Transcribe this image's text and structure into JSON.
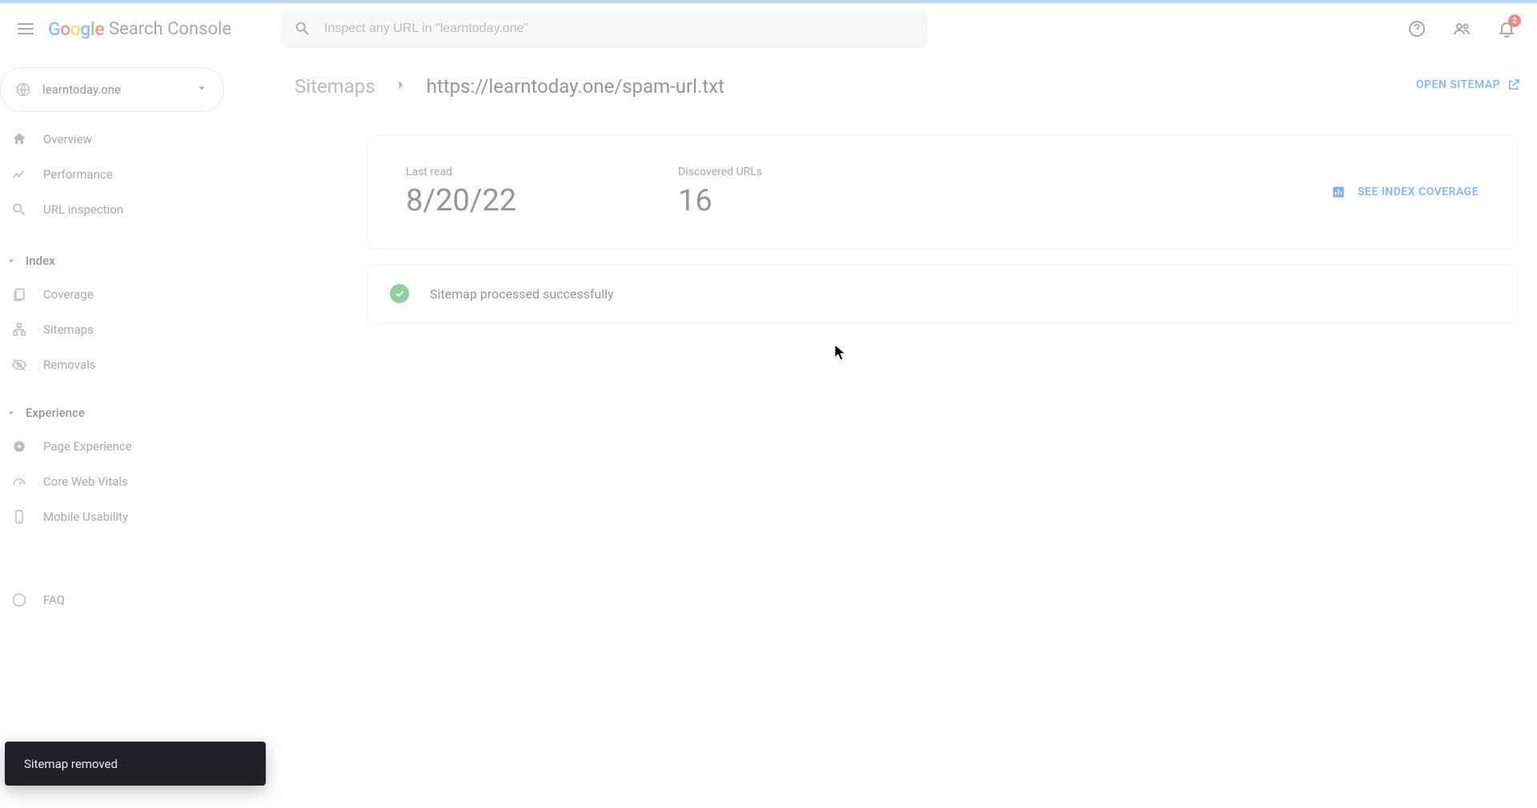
{
  "header": {
    "app_name": "Search Console",
    "search_placeholder": "Inspect any URL in \"learntoday.one\"",
    "notification_count": "2"
  },
  "property": {
    "domain": "learntoday.one"
  },
  "sidebar": {
    "items": [
      {
        "label": "Overview"
      },
      {
        "label": "Performance"
      },
      {
        "label": "URL inspection"
      }
    ],
    "section_index": "Index",
    "index_items": [
      {
        "label": "Coverage"
      },
      {
        "label": "Sitemaps"
      },
      {
        "label": "Removals"
      }
    ],
    "section_experience": "Experience",
    "experience_items": [
      {
        "label": "Page Experience"
      },
      {
        "label": "Core Web Vitals"
      },
      {
        "label": "Mobile Usability"
      }
    ],
    "faq_label": "FAQ"
  },
  "breadcrumb": {
    "root": "Sitemaps",
    "current": "https://learntoday.one/spam-url.txt",
    "open_label": "OPEN SITEMAP"
  },
  "metrics": {
    "last_read_label": "Last read",
    "last_read_value": "8/20/22",
    "discovered_label": "Discovered URLs",
    "discovered_value": "16",
    "coverage_action": "SEE INDEX COVERAGE"
  },
  "status": {
    "text": "Sitemap processed successfully"
  },
  "toast": {
    "text": "Sitemap removed"
  }
}
